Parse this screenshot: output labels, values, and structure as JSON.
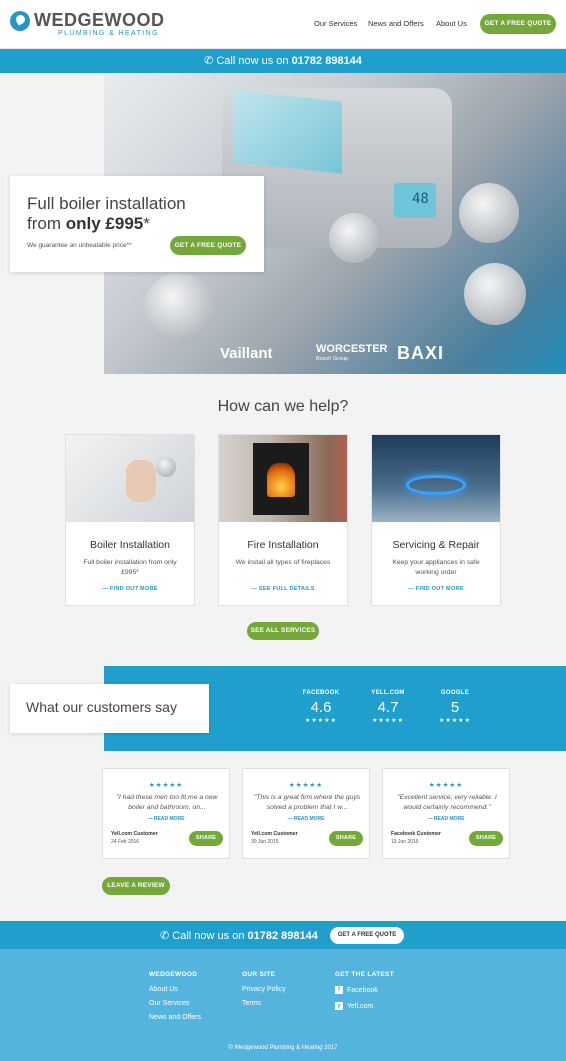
{
  "header": {
    "logo_name": "WEDGEWOOD",
    "logo_tagline": "PLUMBING & HEATING",
    "nav": [
      "Our Services",
      "News and Offers",
      "About Us"
    ],
    "quote_button": "GET A FREE QUOTE"
  },
  "callbar": {
    "prefix": "Call now us on",
    "phone": "01782 898144"
  },
  "hero": {
    "line1": "Full boiler installation",
    "line2_prefix": "from ",
    "line2_bold": "only £995",
    "line2_suffix": "*",
    "subtext": "We guarantee an unbeatable price**",
    "button": "GET A FREE QUOTE",
    "brands": [
      "Vaillant",
      "WORCESTER",
      "Bosch Group",
      "BAXI"
    ],
    "display_value": "48"
  },
  "help": {
    "title": "How can we help?",
    "cards": [
      {
        "title": "Boiler Installation",
        "desc": "Full boiler installation from only £995*",
        "link": "— FIND OUT MORE"
      },
      {
        "title": "Fire Installation",
        "desc": "We install all types of fireplaces",
        "link": "— SEE FULL DETAILS"
      },
      {
        "title": "Servicing & Repair",
        "desc": "Keep your appliances in safe working order",
        "link": "— FIND OUT MORE"
      }
    ],
    "see_all": "SEE ALL SERVICES"
  },
  "customers": {
    "title": "What our customers say",
    "ratings": [
      {
        "name": "FACEBOOK",
        "value": "4.6",
        "stars": "★★★★★"
      },
      {
        "name": "YELL.COM",
        "value": "4.7",
        "stars": "★★★★★"
      },
      {
        "name": "GOOGLE",
        "value": "5",
        "stars": "★★★★★"
      }
    ],
    "reviews": [
      {
        "stars": "★★★★★",
        "text": "\"I had these men too fit me a new boiler and bathroom, on...",
        "more": "— READ MORE",
        "author": "Yell.com Customer",
        "date": "24 Feb 2016",
        "share": "SHARE"
      },
      {
        "stars": "★★★★★",
        "text": "\"This is a great firm where the guys solved a problem that I w...",
        "more": "— READ MORE",
        "author": "Yell.com Customer",
        "date": "30 Jun 2015",
        "share": "SHARE"
      },
      {
        "stars": "★★★★★",
        "text": "\"Excellent service, very reliable. I would certainly recommend.\"",
        "more": "— READ MORE",
        "author": "Facebook Customer",
        "date": "19 Jun 2015",
        "share": "SHARE"
      }
    ],
    "leave_review": "LEAVE A REVIEW"
  },
  "footer": {
    "call_prefix": "Call now us on",
    "call_phone": "01782 898144",
    "quote_button": "GET A FREE QUOTE",
    "col1": {
      "heading": "WEDGEWOOD",
      "links": [
        "About Us",
        "Our Services",
        "News and Offers"
      ]
    },
    "col2": {
      "heading": "OUR SITE",
      "links": [
        "Privacy Policy",
        "Terms"
      ]
    },
    "col3": {
      "heading": "GET THE LATEST",
      "links": [
        "Facebook",
        "Yell.com"
      ]
    },
    "copyright": "© Wedgewood Plumbing & Heating 2017"
  },
  "colors": {
    "brand_blue": "#209fcd",
    "accent_green": "#75a83a",
    "footer_blue": "#55b4de"
  }
}
